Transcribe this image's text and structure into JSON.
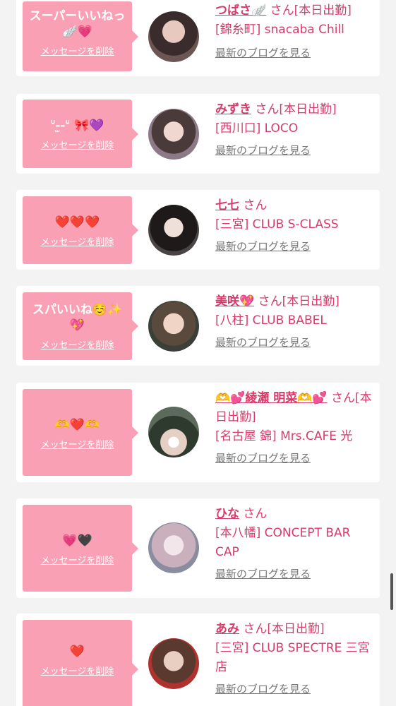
{
  "delete_label": "メッセージを削除",
  "blog_label": "最新のブログを見る",
  "san_label": "さん",
  "entries": [
    {
      "message": "スーパーいいねっ🪽💗",
      "name": "つばさ🪽",
      "status": "[本日出勤]",
      "store": "[錦糸町] snacaba Chill"
    },
    {
      "message": "ᐡ-̫-ᐡ 🎀💜",
      "name": "みずき",
      "status": "[本日出勤]",
      "store": "[西川口] LOCO"
    },
    {
      "message": "❤️❤️❤️",
      "name": "七七",
      "status": "",
      "store": "[三宮] CLUB S-CLASS"
    },
    {
      "message": "スパいいね☺️✨💖",
      "name": "美咲💖",
      "status": "[本日出勤]",
      "store": "[八柱] CLUB BABEL"
    },
    {
      "message": "🫶❤️🫶",
      "name": "🫶💕綾瀬 明菜🫶💕",
      "status": "[本日出勤]",
      "store": "[名古屋 錦] Mrs.CAFE 光"
    },
    {
      "message": "💗🖤",
      "name": "ひな",
      "status": "",
      "store": "[本八幡] CONCEPT BAR CAP"
    },
    {
      "message": "❤️",
      "name": "あみ",
      "status": "[本日出勤]",
      "store": "[三宮] CLUB SPECTRE 三宮店"
    }
  ]
}
